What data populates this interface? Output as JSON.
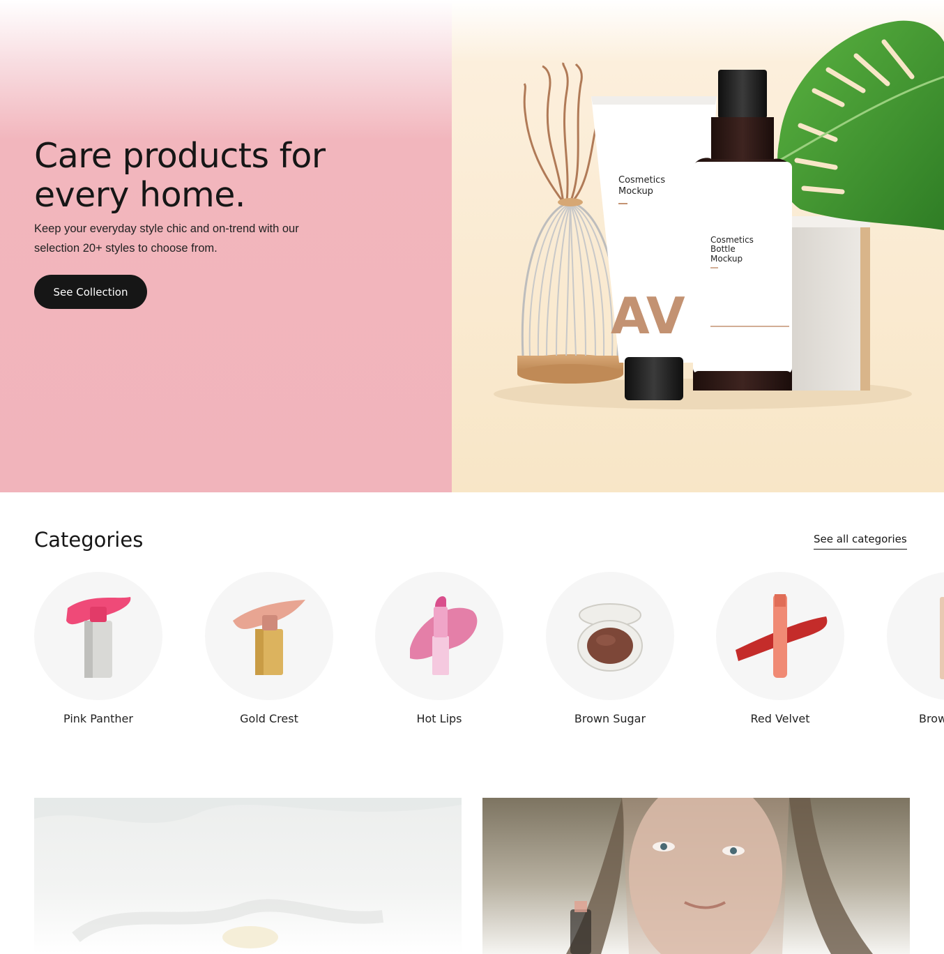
{
  "hero": {
    "title": "Care products for every home.",
    "subtitle": "Keep your everyday style chic and on-trend with our selection 20+ styles to choose from.",
    "cta_label": "See Collection",
    "tube_label_line1": "Cosmetics",
    "tube_label_line2": "Mockup",
    "tube_monogram": "AV",
    "bottle_label_line1": "Cosmetics",
    "bottle_label_line2": "Bottle",
    "bottle_label_line3": "Mockup",
    "colors": {
      "left_bg": "#f1b4bb",
      "right_bg": "#f8e6c7",
      "button": "#161616"
    }
  },
  "categories": {
    "title": "Categories",
    "see_all_label": "See all categories",
    "items": [
      {
        "label": "Pink Panther",
        "icon": "lipstick-stick-icon"
      },
      {
        "label": "Gold Crest",
        "icon": "blush-stick-icon"
      },
      {
        "label": "Hot Lips",
        "icon": "lipstick-icon"
      },
      {
        "label": "Brown Sugar",
        "icon": "compact-powder-icon"
      },
      {
        "label": "Red Velvet",
        "icon": "lip-tint-icon"
      },
      {
        "label": "Brow",
        "icon": "brow-pencil-icon"
      }
    ]
  },
  "promos": [
    {
      "name": "promo-card-left"
    },
    {
      "name": "promo-card-right"
    }
  ]
}
